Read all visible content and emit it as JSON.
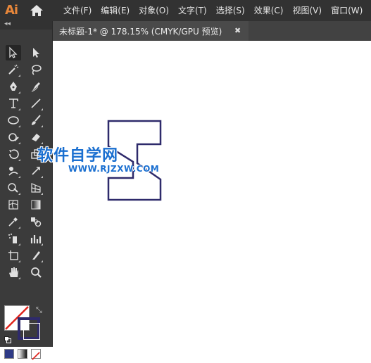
{
  "app": {
    "logo_text": "Ai"
  },
  "menubar": {
    "items": [
      {
        "label": "文件(F)"
      },
      {
        "label": "编辑(E)"
      },
      {
        "label": "对象(O)"
      },
      {
        "label": "文字(T)"
      },
      {
        "label": "选择(S)"
      },
      {
        "label": "效果(C)"
      },
      {
        "label": "视图(V)"
      },
      {
        "label": "窗口(W)"
      }
    ]
  },
  "toolbar": {
    "collapse_label": "◂◂"
  },
  "document_tab": {
    "label": "未标题-1* @ 178.15% (CMYK/GPU 预览)",
    "close_label": "✖"
  },
  "colors": {
    "stroke": "#2e2a6b",
    "accent": "#e8873a",
    "watermark": "#1a6fd0"
  },
  "watermark": {
    "title": "软件自学网",
    "url": "WWW.RJZXW.COM"
  },
  "fill_stroke": {
    "swap_icon": "⤡"
  }
}
